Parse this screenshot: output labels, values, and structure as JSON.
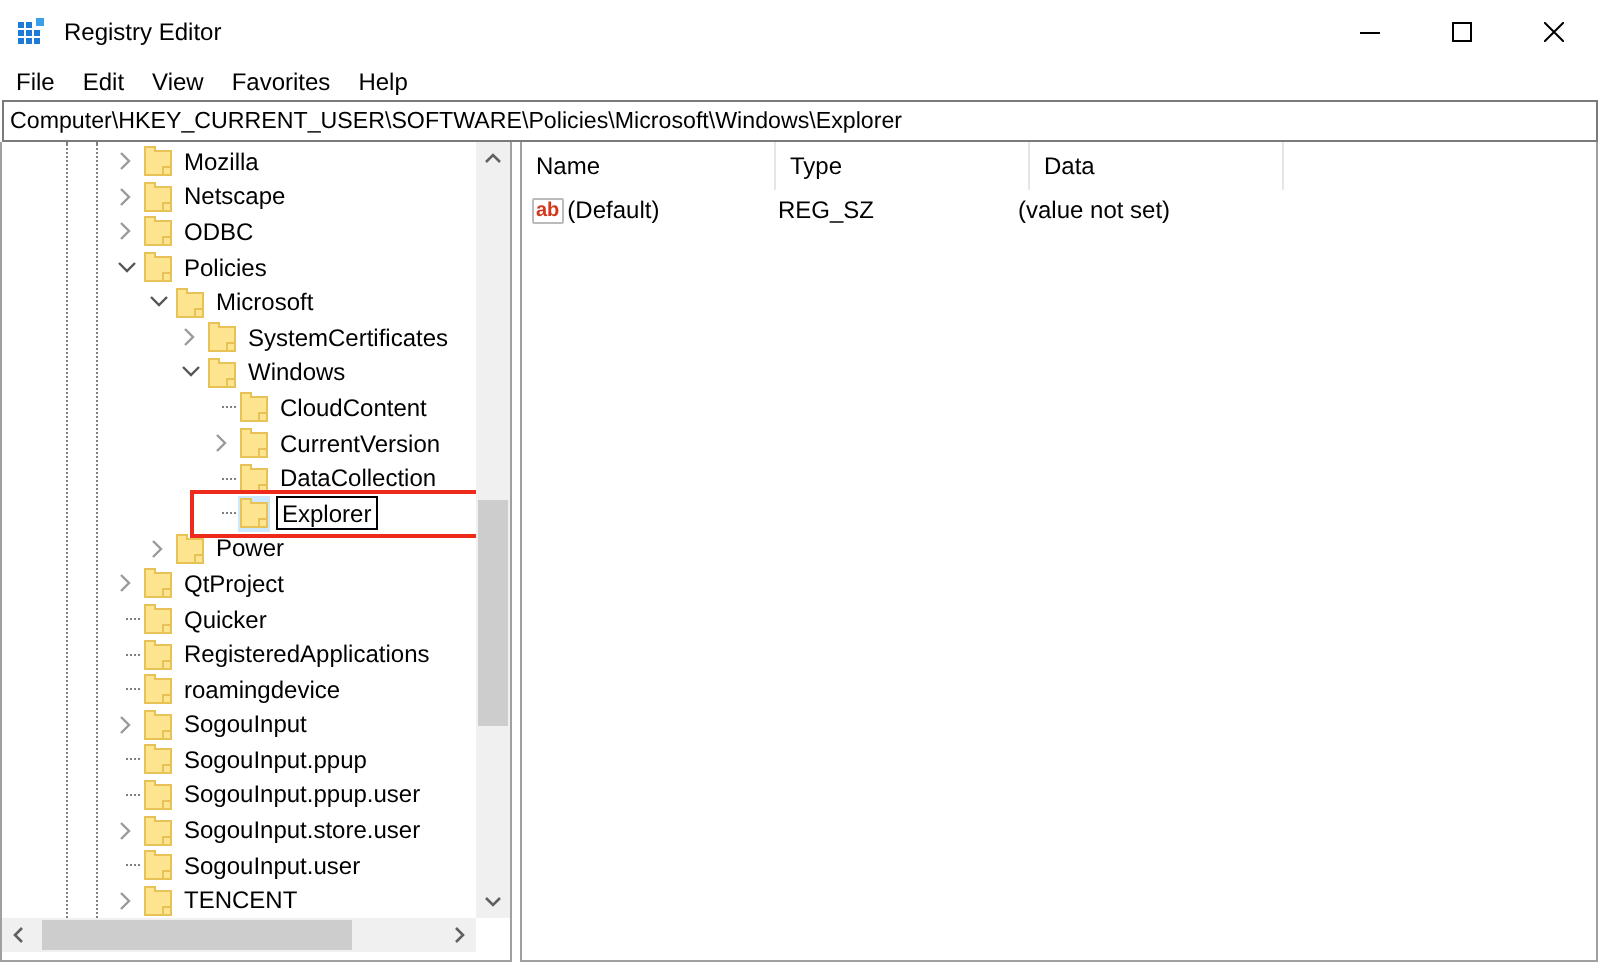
{
  "window": {
    "title": "Registry Editor"
  },
  "menu": [
    "File",
    "Edit",
    "View",
    "Favorites",
    "Help"
  ],
  "address_bar": {
    "value": "Computer\\HKEY_CURRENT_USER\\SOFTWARE\\Policies\\Microsoft\\Windows\\Explorer"
  },
  "tree": [
    {
      "label": "Mozilla",
      "kind": "expandable",
      "expanded": false,
      "selected": false
    },
    {
      "label": "Netscape",
      "kind": "expandable",
      "expanded": false,
      "selected": false
    },
    {
      "label": "ODBC",
      "kind": "expandable",
      "expanded": false,
      "selected": false
    },
    {
      "label": "Policies",
      "kind": "expandable",
      "expanded": true,
      "selected": false,
      "children": [
        {
          "label": "Microsoft",
          "kind": "expandable",
          "expanded": true,
          "selected": false,
          "children": [
            {
              "label": "SystemCertificates",
              "kind": "expandable",
              "expanded": false,
              "selected": false
            },
            {
              "label": "Windows",
              "kind": "expandable",
              "expanded": true,
              "selected": false,
              "children": [
                {
                  "label": "CloudContent",
                  "kind": "leaf",
                  "selected": false
                },
                {
                  "label": "CurrentVersion",
                  "kind": "expandable",
                  "expanded": false,
                  "selected": false
                },
                {
                  "label": "DataCollection",
                  "kind": "leaf",
                  "selected": false
                },
                {
                  "label": "Explorer",
                  "kind": "leaf",
                  "selected": true,
                  "editing": true
                }
              ]
            }
          ]
        },
        {
          "label": "Power",
          "kind": "expandable",
          "expanded": false,
          "selected": false
        }
      ]
    },
    {
      "label": "QtProject",
      "kind": "expandable",
      "expanded": false,
      "selected": false
    },
    {
      "label": "Quicker",
      "kind": "leaf",
      "selected": false
    },
    {
      "label": "RegisteredApplications",
      "kind": "leaf",
      "selected": false
    },
    {
      "label": "roamingdevice",
      "kind": "leaf",
      "selected": false
    },
    {
      "label": "SogouInput",
      "kind": "expandable",
      "expanded": false,
      "selected": false
    },
    {
      "label": "SogouInput.ppup",
      "kind": "leaf",
      "selected": false
    },
    {
      "label": "SogouInput.ppup.user",
      "kind": "leaf",
      "selected": false
    },
    {
      "label": "SogouInput.store.user",
      "kind": "expandable",
      "expanded": false,
      "selected": false
    },
    {
      "label": "SogouInput.user",
      "kind": "leaf",
      "selected": false
    },
    {
      "label": "TENCENT",
      "kind": "expandable",
      "expanded": false,
      "selected": false
    }
  ],
  "values": {
    "columns": [
      "Name",
      "Type",
      "Data"
    ],
    "rows": [
      {
        "icon_text": "ab",
        "name": "(Default)",
        "type": "REG_SZ",
        "data": "(value not set)"
      }
    ]
  }
}
